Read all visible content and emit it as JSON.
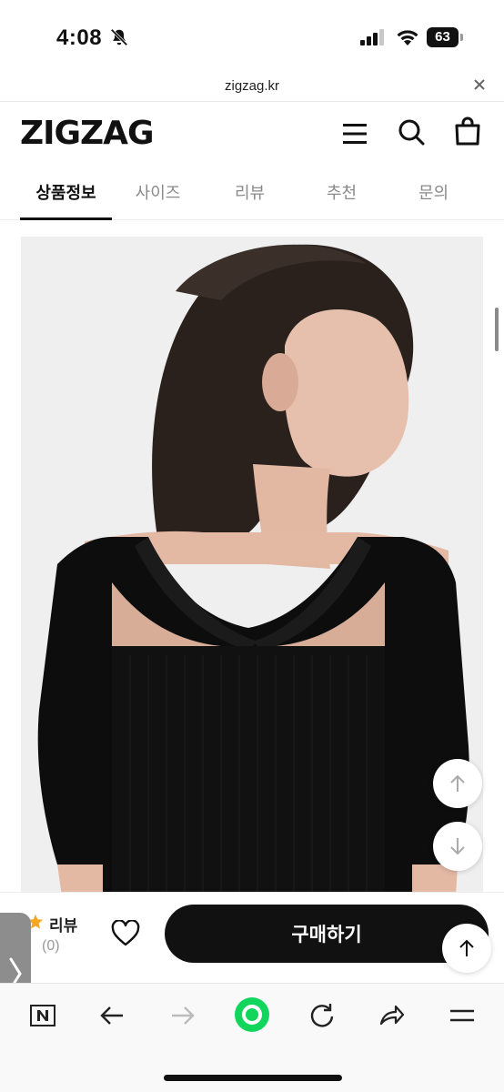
{
  "status_bar": {
    "time": "4:08",
    "battery": "63"
  },
  "browser": {
    "url": "zigzag.kr"
  },
  "header": {
    "logo": "ZIGZAG"
  },
  "tabs": [
    {
      "label": "상품정보",
      "active": true
    },
    {
      "label": "사이즈",
      "active": false
    },
    {
      "label": "리뷰",
      "active": false
    },
    {
      "label": "추천",
      "active": false
    },
    {
      "label": "문의",
      "active": false
    }
  ],
  "purchase_bar": {
    "review_label": "리뷰",
    "review_count": "(0)",
    "buy_label": "구매하기"
  },
  "colors": {
    "accent_star": "#f5a623",
    "button_bg": "#111111",
    "active_tab": "#111111",
    "inactive_tab": "#8a8a8a"
  },
  "icons": [
    "bell-slash-icon",
    "signal-icon",
    "wifi-icon",
    "close-icon",
    "menu-icon",
    "search-icon",
    "shopping-bag-icon",
    "arrow-up-icon",
    "arrow-down-icon",
    "star-icon",
    "heart-icon",
    "chevron-right-icon",
    "naver-n-icon",
    "back-arrow-icon",
    "forward-arrow-icon",
    "green-dot-icon",
    "refresh-icon",
    "share-icon",
    "hamburger-icon"
  ]
}
